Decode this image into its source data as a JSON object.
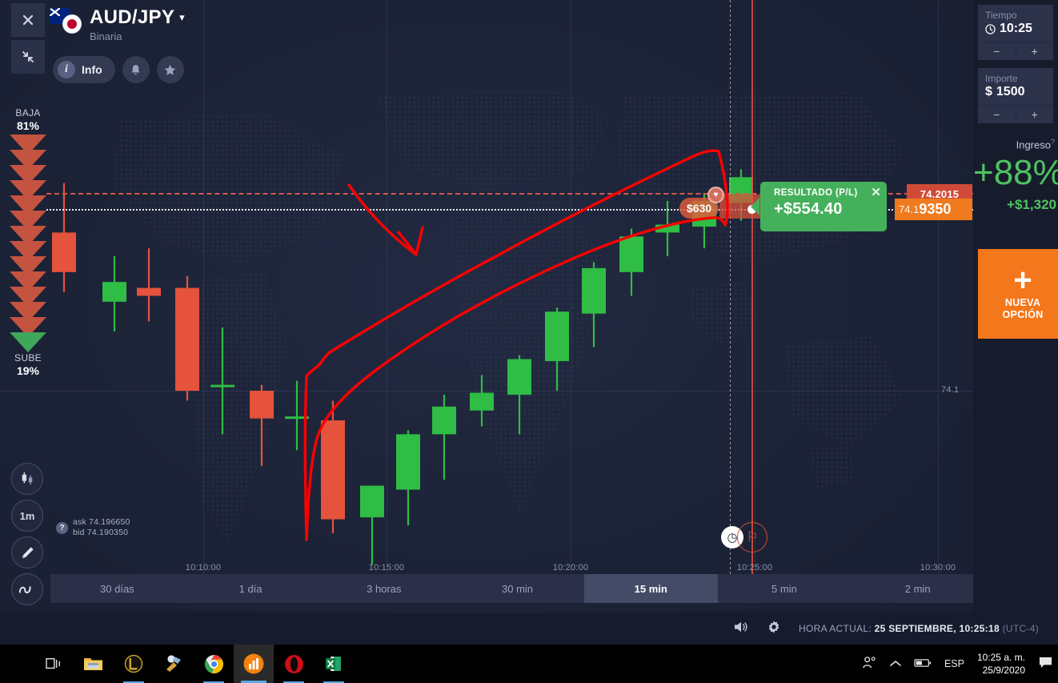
{
  "window": {
    "close_icon": "close-icon",
    "collapse_icon": "collapse-icon"
  },
  "instrument": {
    "pair": "AUD/JPY",
    "caret": "▾",
    "type": "Binaria",
    "flag_left": "australia-flag",
    "flag_right": "japan-flag"
  },
  "actions": {
    "info_label": "Info",
    "info_icon": "i",
    "bell_icon": "🔔",
    "star_icon": "★"
  },
  "sentiment": {
    "down_label": "BAJA",
    "down_pct": "81%",
    "up_label": "SUBE",
    "up_pct": "19%",
    "down_color": "#c4533f",
    "up_color": "#3ea75a"
  },
  "tools": {
    "candles": "candles-icon",
    "timeframe": "1m",
    "draw": "pencil-icon",
    "indicators": "wave-icon"
  },
  "quotes": {
    "help_icon": "?",
    "ask": "ask 74.196650",
    "bid": "bid 74.190350"
  },
  "trade_markers": {
    "investment_badge": "$630",
    "badge_icon": "heart-icon",
    "result_title": "RESULTADO (P/L)",
    "result_value": "+$554.40",
    "result_close": "✕",
    "tag_ask": "74.2015",
    "tag_bid_small": "74.1",
    "tag_bid_big": "9350",
    "clock_icon": "timer-icon",
    "flag_icon": "checkered-flag-icon"
  },
  "timeframes": [
    {
      "label": "30 días",
      "active": false
    },
    {
      "label": "1 día",
      "active": false
    },
    {
      "label": "3 horas",
      "active": false
    },
    {
      "label": "30 min",
      "active": false
    },
    {
      "label": "15 min",
      "active": true
    },
    {
      "label": "5 min",
      "active": false
    },
    {
      "label": "2 min",
      "active": false
    }
  ],
  "trade_panel": {
    "time_label": "Tiempo",
    "time_value": "10:25",
    "time_icon": "clock-icon",
    "amount_label": "Importe",
    "amount_currency": "$",
    "amount_value": "1500",
    "minus": "−",
    "plus": "+",
    "income_label": "Ingreso",
    "income_help": "?",
    "income_pct": "+88%",
    "income_amount": "+$1,320",
    "new_option_plus": "+",
    "new_option_label": "NUEVA\nOPCIÓN",
    "accent_orange": "#f5771b",
    "accent_green": "#4fc361"
  },
  "status_bar": {
    "sound_icon": "speaker-icon",
    "settings_icon": "gear-icon",
    "label": "HORA ACTUAL:",
    "datetime": "25 SEPTIEMBRE, 10:25:18",
    "timezone": "(UTC-4)"
  },
  "taskbar": {
    "items": [
      {
        "name": "task-view",
        "glyph": "⧉"
      },
      {
        "name": "file-explorer",
        "glyph": "📁"
      },
      {
        "name": "league-of-legends",
        "glyph": "L"
      },
      {
        "name": "paint-app",
        "glyph": "🖌"
      },
      {
        "name": "google-chrome",
        "glyph": "◉"
      },
      {
        "name": "trading-app",
        "glyph": "▮▮▮"
      },
      {
        "name": "opera-browser",
        "glyph": "O"
      },
      {
        "name": "microsoft-excel",
        "glyph": "X"
      }
    ],
    "tray": {
      "people_icon": "people-icon",
      "chevron_icon": "⌃",
      "battery_icon": "battery-icon",
      "language": "ESP",
      "time": "10:25 a. m.",
      "date": "25/9/2020",
      "notifications_icon": "notification-icon"
    }
  },
  "chart_data": {
    "type": "candlestick",
    "title": "AUD/JPY Binaria — 15 min",
    "xlabel": "",
    "ylabel": "",
    "x_ticks": [
      "10:10:00",
      "10:15:00",
      "10:20:00",
      "10:25:00",
      "10:30:00"
    ],
    "y_ticks": [
      "74.1"
    ],
    "price_lines": [
      {
        "name": "ask",
        "value": 74.2015,
        "style": "dashed",
        "color": "#d05a4a"
      },
      {
        "name": "bid",
        "value": 74.1935,
        "style": "dotted",
        "color": "#ffffff"
      }
    ],
    "annotations": [
      {
        "type": "ascending-channel",
        "color": "#ff0000",
        "note": "hand-drawn rising wedge"
      },
      {
        "type": "arrow",
        "color": "#ff0000",
        "note": "hand-drawn down arrow"
      }
    ],
    "candles": [
      {
        "x": 22,
        "open": 74.18,
        "high": 74.205,
        "low": 74.15,
        "close": 74.16,
        "dir": "down"
      },
      {
        "x": 85,
        "open": 74.145,
        "high": 74.168,
        "low": 74.13,
        "close": 74.155,
        "dir": "up"
      },
      {
        "x": 128,
        "open": 74.152,
        "high": 74.172,
        "low": 74.135,
        "close": 74.148,
        "dir": "down"
      },
      {
        "x": 176,
        "open": 74.152,
        "high": 74.158,
        "low": 74.095,
        "close": 74.1,
        "dir": "down"
      },
      {
        "x": 220,
        "open": 74.103,
        "high": 74.132,
        "low": 74.078,
        "close": 74.103,
        "dir": "up"
      },
      {
        "x": 269,
        "open": 74.1,
        "high": 74.103,
        "low": 74.062,
        "close": 74.086,
        "dir": "down"
      },
      {
        "x": 313,
        "open": 74.087,
        "high": 74.105,
        "low": 74.07,
        "close": 74.087,
        "dir": "up"
      },
      {
        "x": 358,
        "open": 74.085,
        "high": 74.095,
        "low": 74.028,
        "close": 74.035,
        "dir": "down"
      },
      {
        "x": 407,
        "open": 74.036,
        "high": 74.052,
        "low": 74.012,
        "close": 74.052,
        "dir": "up"
      },
      {
        "x": 452,
        "open": 74.05,
        "high": 74.08,
        "low": 74.032,
        "close": 74.078,
        "dir": "up"
      },
      {
        "x": 497,
        "open": 74.078,
        "high": 74.098,
        "low": 74.055,
        "close": 74.092,
        "dir": "up"
      },
      {
        "x": 544,
        "open": 74.09,
        "high": 74.108,
        "low": 74.082,
        "close": 74.099,
        "dir": "up"
      },
      {
        "x": 591,
        "open": 74.098,
        "high": 74.118,
        "low": 74.078,
        "close": 74.116,
        "dir": "up"
      },
      {
        "x": 638,
        "open": 74.115,
        "high": 74.142,
        "low": 74.1,
        "close": 74.14,
        "dir": "up"
      },
      {
        "x": 684,
        "open": 74.139,
        "high": 74.165,
        "low": 74.122,
        "close": 74.162,
        "dir": "up"
      },
      {
        "x": 731,
        "open": 74.16,
        "high": 74.182,
        "low": 74.148,
        "close": 74.178,
        "dir": "up"
      },
      {
        "x": 776,
        "open": 74.18,
        "high": 74.196,
        "low": 74.168,
        "close": 74.184,
        "dir": "up"
      },
      {
        "x": 822,
        "open": 74.183,
        "high": 74.2,
        "low": 74.172,
        "close": 74.196,
        "dir": "up"
      },
      {
        "x": 868,
        "open": 74.195,
        "high": 74.212,
        "low": 74.186,
        "close": 74.208,
        "dir": "up"
      }
    ],
    "colors": {
      "up": "#2fbd45",
      "down": "#e5533c"
    }
  }
}
